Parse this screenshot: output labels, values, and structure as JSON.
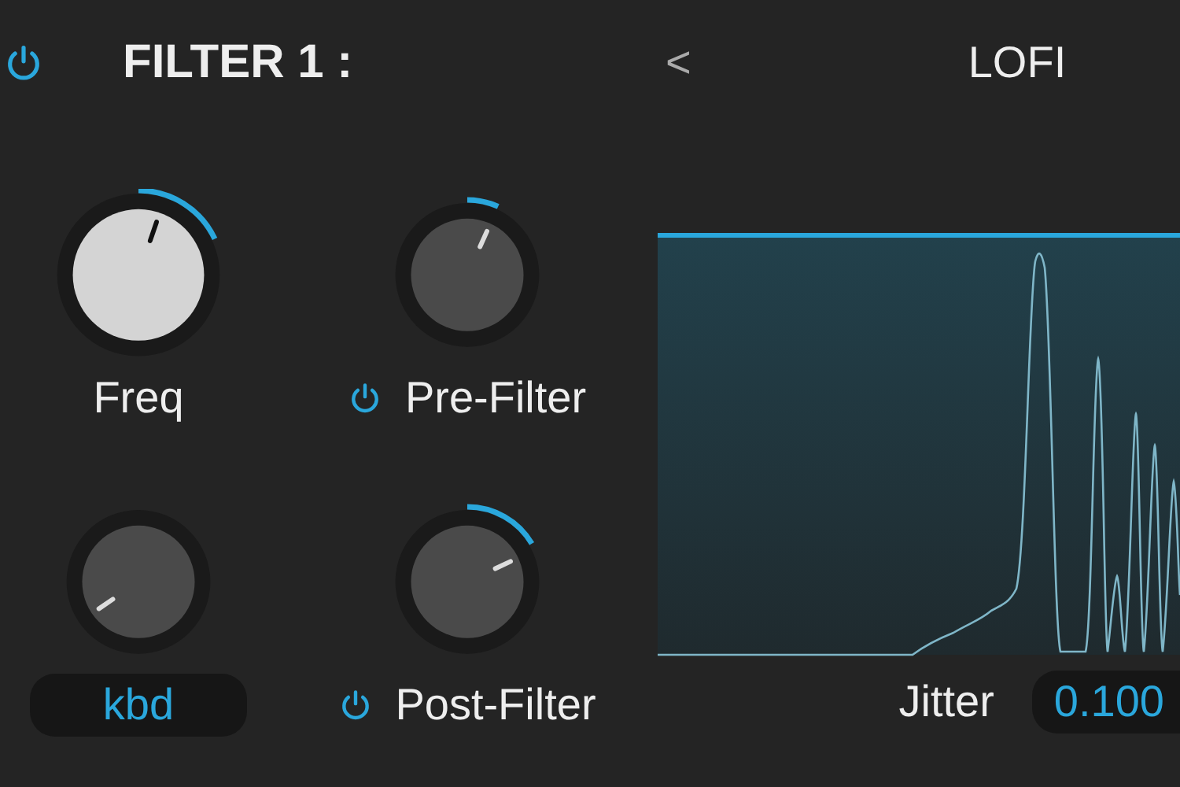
{
  "header": {
    "power": {
      "on": true
    },
    "title": "FILTER 1 :",
    "back": "<",
    "preset": "LOFI"
  },
  "knobs": [
    {
      "label": "Freq",
      "kind": "label",
      "selected": true
    },
    {
      "label": "Pre-Filter",
      "kind": "switch",
      "selected": false,
      "on": true
    },
    {
      "label": "kbd",
      "kind": "value",
      "selected": false
    },
    {
      "label": "Post-Filter",
      "kind": "switch",
      "selected": false,
      "on": true
    }
  ],
  "effect": {
    "param": "Jitter",
    "value": "0.100"
  }
}
